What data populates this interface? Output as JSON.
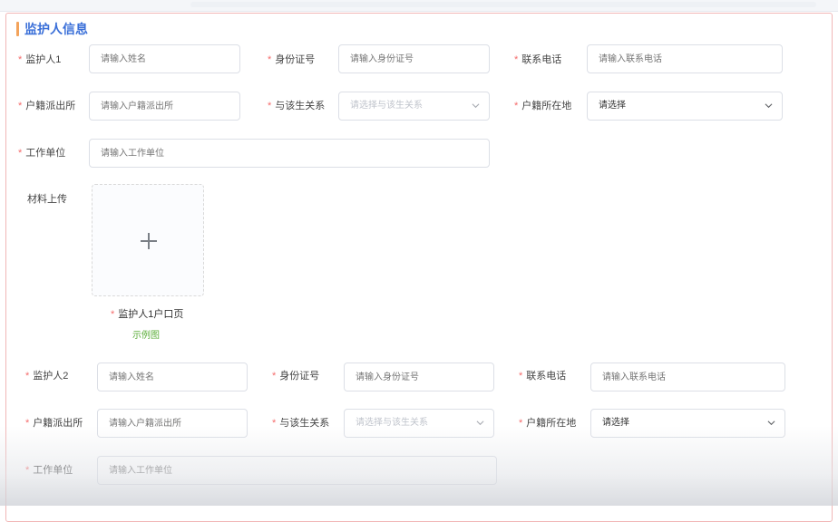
{
  "section": {
    "title": "监护人信息"
  },
  "guardian1": {
    "name_label": "监护人1",
    "name_placeholder": "请输入姓名",
    "id_label": "身份证号",
    "id_placeholder": "请输入身份证号",
    "phone_label": "联系电话",
    "phone_placeholder": "请输入联系电话",
    "police_label": "户籍派出所",
    "police_placeholder": "请输入户籍派出所",
    "relation_label": "与该生关系",
    "relation_placeholder": "请选择与该生关系",
    "location_label": "户籍所在地",
    "location_value": "请选择",
    "work_label": "工作单位",
    "work_placeholder": "请输入工作单位"
  },
  "materials": {
    "label": "材料上传",
    "upload_caption": "监护人1户口页",
    "sample_link": "示例图"
  },
  "guardian2": {
    "name_label": "监护人2",
    "name_placeholder": "请输入姓名",
    "id_label": "身份证号",
    "id_placeholder": "请输入身份证号",
    "phone_label": "联系电话",
    "phone_placeholder": "请输入联系电话",
    "police_label": "户籍派出所",
    "police_placeholder": "请输入户籍派出所",
    "relation_label": "与该生关系",
    "relation_placeholder": "请选择与该生关系",
    "location_label": "户籍所在地",
    "location_value": "请选择",
    "work_label": "工作单位",
    "work_placeholder": "请输入工作单位"
  },
  "colors": {
    "accent": "#3a6fd8",
    "title_bar": "#f3a35b",
    "required": "#f56c6c",
    "link": "#5cae3a",
    "panel_border": "#f1b6b6"
  },
  "icons": {
    "upload": "plus-icon",
    "select": "chevron-down-icon"
  }
}
